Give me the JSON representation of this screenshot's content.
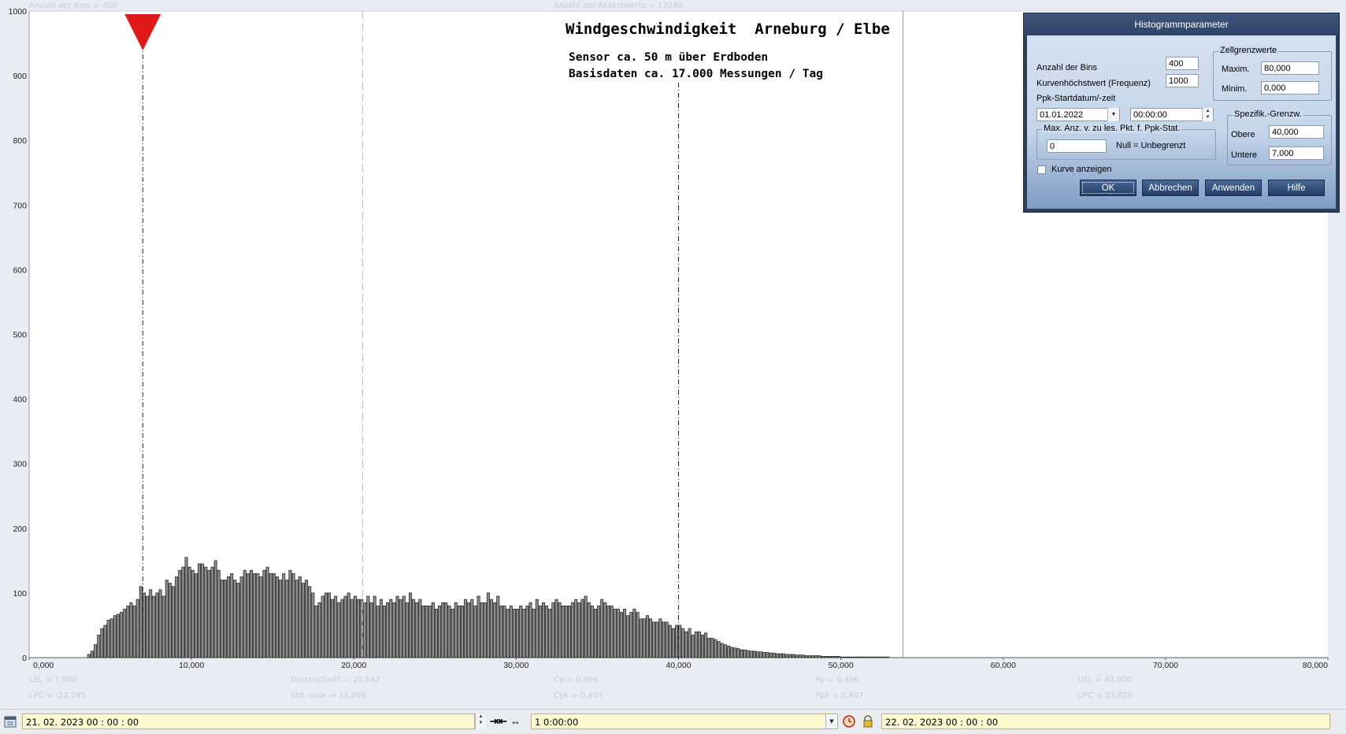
{
  "header": {
    "bins_info": "Anzahl der Bins =   400",
    "samples_info": "Anzahl der Abtastwerte = 17248"
  },
  "chart_data": {
    "type": "bar",
    "title": "Windgeschwindigkeit  Arneburg / Elbe",
    "subtitle_lines": [
      "Sensor ca. 50 m über Erdboden",
      "Basisdaten ca. 17.000 Messungen / Tag"
    ],
    "xlim": [
      0,
      80
    ],
    "ylim": [
      0,
      1000
    ],
    "x_tick_labels": [
      "0,000",
      "10,000",
      "20,000",
      "30,000",
      "40,000",
      "50,000",
      "60,000",
      "70,000",
      "80,000"
    ],
    "y_tick_labels": [
      "0",
      "100",
      "200",
      "300",
      "400",
      "500",
      "600",
      "700",
      "800",
      "900",
      "1000"
    ],
    "bin_width": 0.2,
    "bin_start": 0,
    "values": [
      0,
      0,
      0,
      0,
      0,
      0,
      0,
      0,
      0,
      0,
      0,
      0,
      0,
      0,
      0,
      0,
      0,
      0,
      5,
      10,
      20,
      35,
      45,
      50,
      58,
      60,
      65,
      67,
      70,
      75,
      80,
      85,
      80,
      90,
      110,
      100,
      95,
      105,
      95,
      100,
      105,
      95,
      120,
      115,
      110,
      125,
      135,
      140,
      155,
      140,
      135,
      130,
      145,
      145,
      140,
      135,
      140,
      150,
      135,
      120,
      120,
      125,
      130,
      120,
      115,
      125,
      135,
      130,
      135,
      130,
      130,
      125,
      135,
      140,
      130,
      130,
      125,
      120,
      130,
      120,
      135,
      130,
      120,
      125,
      115,
      120,
      110,
      100,
      80,
      85,
      95,
      100,
      100,
      90,
      95,
      85,
      90,
      95,
      100,
      90,
      95,
      90,
      90,
      85,
      95,
      85,
      95,
      80,
      90,
      80,
      85,
      90,
      85,
      95,
      90,
      95,
      85,
      100,
      90,
      85,
      90,
      80,
      80,
      80,
      85,
      75,
      80,
      85,
      85,
      80,
      75,
      85,
      80,
      80,
      90,
      85,
      90,
      80,
      95,
      85,
      85,
      100,
      90,
      85,
      95,
      80,
      80,
      75,
      80,
      75,
      75,
      80,
      75,
      80,
      85,
      75,
      90,
      80,
      85,
      80,
      75,
      85,
      90,
      85,
      80,
      80,
      80,
      85,
      90,
      85,
      90,
      95,
      85,
      80,
      75,
      80,
      90,
      85,
      80,
      80,
      75,
      75,
      70,
      75,
      65,
      70,
      75,
      70,
      60,
      60,
      65,
      60,
      55,
      55,
      60,
      55,
      55,
      50,
      45,
      50,
      50,
      45,
      40,
      45,
      35,
      40,
      40,
      35,
      38,
      30,
      30,
      28,
      25,
      22,
      20,
      18,
      16,
      15,
      14,
      12,
      12,
      11,
      10,
      10,
      9,
      9,
      8,
      8,
      7,
      7,
      6,
      6,
      6,
      5,
      5,
      5,
      4,
      4,
      4,
      3,
      3,
      3,
      3,
      3,
      2,
      2,
      2,
      2,
      2,
      2,
      1,
      1,
      1,
      1,
      1,
      1,
      1,
      1,
      1,
      1,
      1,
      1,
      1,
      1,
      1
    ],
    "vertical_lines": [
      {
        "label": "LSL",
        "x": 7.0,
        "style": "dashdot"
      },
      {
        "label": "Durchschnitt",
        "x": 20.542,
        "style": "dashed-light"
      },
      {
        "label": "USL",
        "x": 40.0,
        "style": "dashdot"
      },
      {
        "label": "UPC",
        "x": 53.829,
        "style": "solid-gray"
      }
    ],
    "marker": {
      "x": 7.0,
      "shape": "triangle-down",
      "color": "#e11919"
    }
  },
  "stats": {
    "row1": [
      "LSL = 7,000",
      "Durchschnitt  = 20,542",
      "Cp  = 0,496",
      "Pp  = 0,496",
      "USL = 40,000"
    ],
    "row2": [
      "LPC = -12,745",
      "Std.-abw. = 11,096",
      "Cpk = 0,407",
      "Ppk = 0,407",
      "UPC = 53,829"
    ]
  },
  "dialog": {
    "title": "Histogrammparameter",
    "bins_label": "Anzahl der Bins",
    "bins_value": "400",
    "curve_max_label": "Kurvenhöchstwert (Frequenz)",
    "curve_max_value": "1000",
    "ppk_start_label": "Ppk-Startdatum/-zeit",
    "ppk_date": "01.01.2022",
    "ppk_time": "00:00:00",
    "max_points_group": "Max. Anz. v. zu les. Pkt. f. Ppk-Stat.",
    "max_points_value": "0",
    "max_points_hint": "Null = Unbegrenzt",
    "show_curve_label": "Kurve anzeigen",
    "cell_limits_group": "Zellgrenzwerte",
    "maxim_label": "Maxim.",
    "maxim_value": "80,000",
    "minim_label": "Minim.",
    "minim_value": "0,000",
    "spec_group": "Spezifik.-Grenzw.",
    "upper_label": "Obere",
    "upper_value": "40,000",
    "lower_label": "Untere",
    "lower_value": "7,000",
    "ok_label": "OK",
    "cancel_label": "Abbrechen",
    "apply_label": "Anwenden",
    "help_label": "Hilfe"
  },
  "toolbar": {
    "start_datetime": "21. 02. 2023   00 : 00 : 00",
    "interval": "1  0:00:00",
    "end_datetime": "22. 02. 2023   00 : 00 : 00"
  }
}
